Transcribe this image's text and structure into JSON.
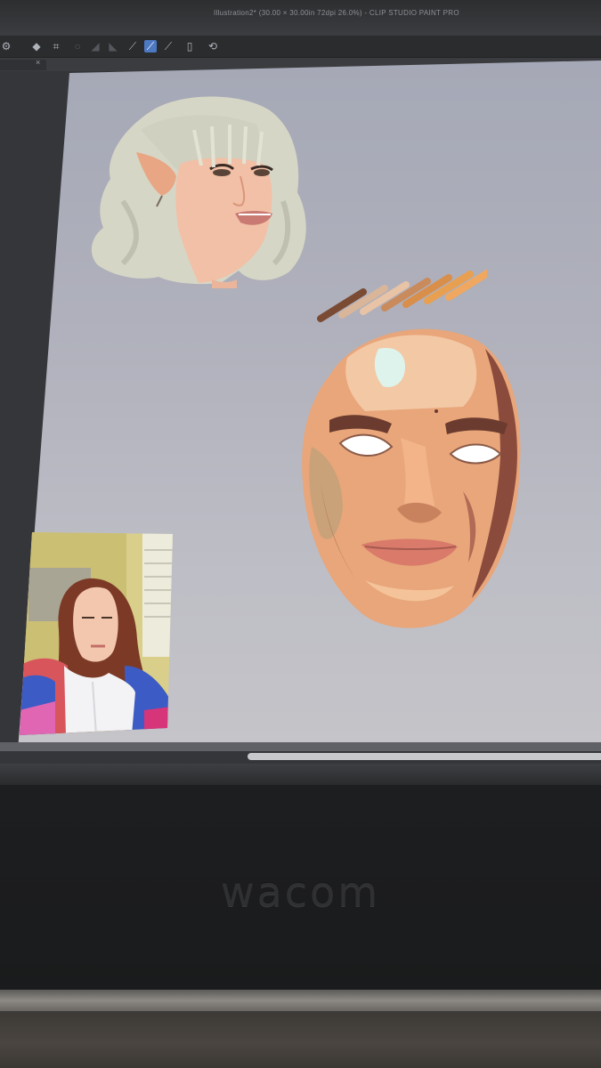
{
  "window": {
    "title": "Illustration2* (30.00 × 30.00in 72dpi 26.0%) - CLIP STUDIO PAINT PRO"
  },
  "toolbar": {
    "icons": [
      "gear-icon",
      "blank-icon",
      "fill-icon",
      "transform-icon",
      "divider-icon",
      "undo-icon",
      "redo-icon",
      "pen-line-icon",
      "pen-active-icon",
      "pen-alt-icon",
      "ruler-icon",
      "blank-icon",
      "settings-icon"
    ]
  },
  "document_tab": {
    "close_label": "×"
  },
  "canvas": {
    "background_color": "#b0b2bd",
    "artworks": [
      "elf-portrait-painting",
      "color-swatch-strokes",
      "stylized-face-painting"
    ]
  },
  "swatches": [
    "#7a4a33",
    "#d9b59a",
    "#e8c3a6",
    "#c98a5c",
    "#d98e4a",
    "#e8a050",
    "#f0a860"
  ],
  "video_call": {
    "label": "self-view-video"
  },
  "hardware": {
    "brand": "wacom"
  }
}
